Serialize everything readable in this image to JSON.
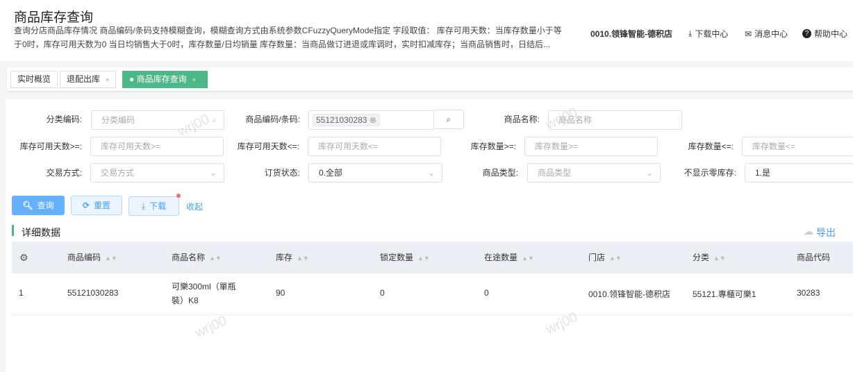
{
  "header": {
    "title": "商品库存查询",
    "description": "查询分店商品库存情况 商品编码/条码支持模糊查询，模糊查询方式由系统参数CFuzzyQueryMode指定 字段取值： 库存可用天数：当库存数量小于等于0时，库存可用天数为0 当日均销售大于0时，库存数量/日均销量 库存数量：当商品做订进退或库调时，实时扣减库存；当商品销售时，日结后...",
    "store": "0010.领锋智能-德积店",
    "download_center": "下载中心",
    "message_center": "消息中心",
    "help_center": "帮助中心"
  },
  "tabs": [
    {
      "label": "实时概览"
    },
    {
      "label": "退配出库",
      "close": "×"
    },
    {
      "label": "商品库存查询",
      "close": "×"
    }
  ],
  "filters": {
    "category_label": "分类编码:",
    "category_placeholder": "分类编码",
    "code_label": "商品编码/条码:",
    "code_tag": "55121030283",
    "name_label": "商品名称:",
    "name_placeholder": "商品名称",
    "days_ge_label": "库存可用天数>=:",
    "days_ge_placeholder": "库存可用天数>=",
    "days_le_label": "库存可用天数<=:",
    "days_le_placeholder": "库存可用天数<=",
    "qty_ge_label": "库存数量>=:",
    "qty_ge_placeholder": "库存数量>=",
    "qty_le_label": "库存数量<=:",
    "qty_le_placeholder": "库存数量<=",
    "trade_label": "交易方式:",
    "trade_placeholder": "交易方式",
    "order_label": "订货状态:",
    "order_value": "0.全部",
    "type_label": "商品类型:",
    "type_placeholder": "商品类型",
    "zero_label": "不显示零库存:",
    "zero_value": "1.是"
  },
  "actions": {
    "query": "查询",
    "reset": "重置",
    "download": "下载",
    "collapse": "收起"
  },
  "section": {
    "title": "详细数据",
    "export": "导出"
  },
  "table": {
    "columns": [
      "商品编码",
      "商品名称",
      "库存",
      "锁定数量",
      "在途数量",
      "门店",
      "分类",
      "商品代码"
    ],
    "rows": [
      [
        "1",
        "55121030283",
        "可樂300ml（單瓶裝）K8",
        "90",
        "0",
        "0",
        "0010.领锋智能-德积店",
        "55121.專櫃可樂1",
        "30283"
      ]
    ]
  },
  "watermark": "wrj00",
  "colors": {
    "accent": "#4db887",
    "primary": "#3a8ee6"
  }
}
